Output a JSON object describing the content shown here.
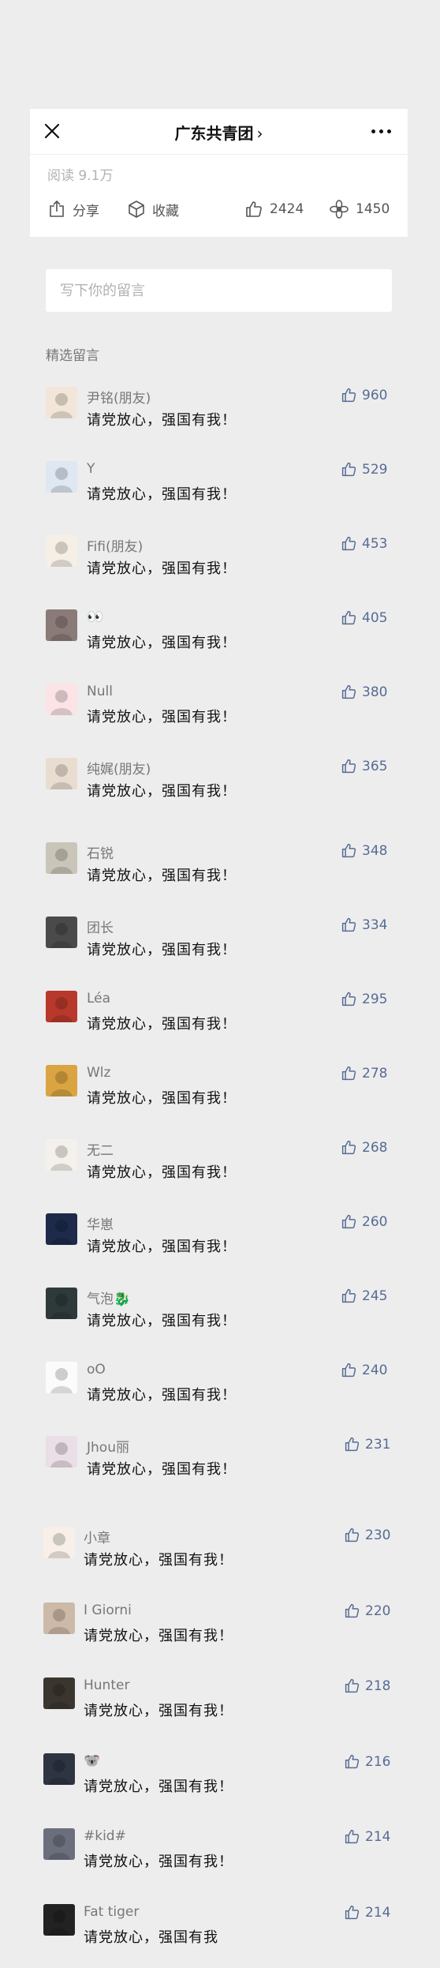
{
  "header": {
    "title": "广东共青团",
    "title_chevron": "›",
    "reads": "阅读 9.1万"
  },
  "actions": {
    "share": "分享",
    "favorite": "收藏",
    "like_count": "2424",
    "wow_count": "1450"
  },
  "comment_input": {
    "placeholder": "写下你的留言"
  },
  "comments_section": {
    "title": "精选留言",
    "items": [
      {
        "name": "尹铭(朋友)",
        "text": "请党放心，强国有我！",
        "likes": "960",
        "avatar": "boy-glasses",
        "color": "#f3e6d8"
      },
      {
        "name": "Y",
        "text": "请党放心，强国有我！",
        "likes": "529",
        "avatar": "blue-hands",
        "color": "#dfe7f3"
      },
      {
        "name": "Fifi(朋友)",
        "text": "请党放心，强国有我！",
        "likes": "453",
        "avatar": "girl-cartoon",
        "color": "#f6efe6"
      },
      {
        "name": "👀",
        "text": "请党放心，强国有我！",
        "likes": "405",
        "avatar": "portrait-dark",
        "color": "#8a7a78"
      },
      {
        "name": "Null",
        "text": "请党放心，强国有我！",
        "likes": "380",
        "avatar": "pig",
        "color": "#fbe3e6"
      },
      {
        "name": "纯娓(朋友)",
        "text": "请党放心，强国有我！",
        "likes": "365",
        "avatar": "beige-figure",
        "color": "#e9ddd0"
      },
      {
        "name": "石锐",
        "text": "请党放心，强国有我！",
        "likes": "348",
        "avatar": "sketch-man",
        "color": "#c9c5b8"
      },
      {
        "name": "团长",
        "text": "请党放心，强国有我！",
        "likes": "334",
        "avatar": "raccoon",
        "color": "#4a4a4a"
      },
      {
        "name": "Léa",
        "text": "请党放心，强国有我！",
        "likes": "295",
        "avatar": "red-poster",
        "color": "#b8392b"
      },
      {
        "name": "Wlz",
        "text": "请党放心，强国有我！",
        "likes": "278",
        "avatar": "yellow-face",
        "color": "#d9a441"
      },
      {
        "name": "无二",
        "text": "请党放心，强国有我！",
        "likes": "268",
        "avatar": "white-flower",
        "color": "#f4f1ec"
      },
      {
        "name": "华崽",
        "text": "请党放心，强国有我！",
        "likes": "260",
        "avatar": "night-sky",
        "color": "#1d2a4a"
      },
      {
        "name": "气泡🐉",
        "text": "请党放心，强国有我！",
        "likes": "245",
        "avatar": "dark-scene",
        "color": "#2e3a3a"
      },
      {
        "name": "oO",
        "text": "请党放心，强国有我！",
        "likes": "240",
        "avatar": "black-cat",
        "color": "#fbfbfb"
      },
      {
        "name": "Jhou丽",
        "text": "请党放心，强国有我！",
        "likes": "231",
        "avatar": "girl-photo",
        "color": "#eadfe6"
      },
      {
        "name": "小章",
        "text": "请党放心，强国有我！",
        "likes": "230",
        "avatar": "cartoon-kid",
        "color": "#f7efe8"
      },
      {
        "name": "I Giorni",
        "text": "请党放心，强国有我！",
        "likes": "220",
        "avatar": "room-photo",
        "color": "#cdb9a8"
      },
      {
        "name": "Hunter",
        "text": "请党放心，强国有我！",
        "likes": "218",
        "avatar": "dark-animal",
        "color": "#3b3530"
      },
      {
        "name": "🐨",
        "text": "请党放心，强国有我！",
        "likes": "216",
        "avatar": "dark-portrait",
        "color": "#2f3442"
      },
      {
        "name": "#kid#",
        "text": "请党放心，强国有我！",
        "likes": "214",
        "avatar": "anime-boy",
        "color": "#6b6f7d"
      },
      {
        "name": "Fat tiger",
        "text": "请党放心，强国有我",
        "likes": "214",
        "avatar": "black-white-face",
        "color": "#222222"
      }
    ]
  }
}
